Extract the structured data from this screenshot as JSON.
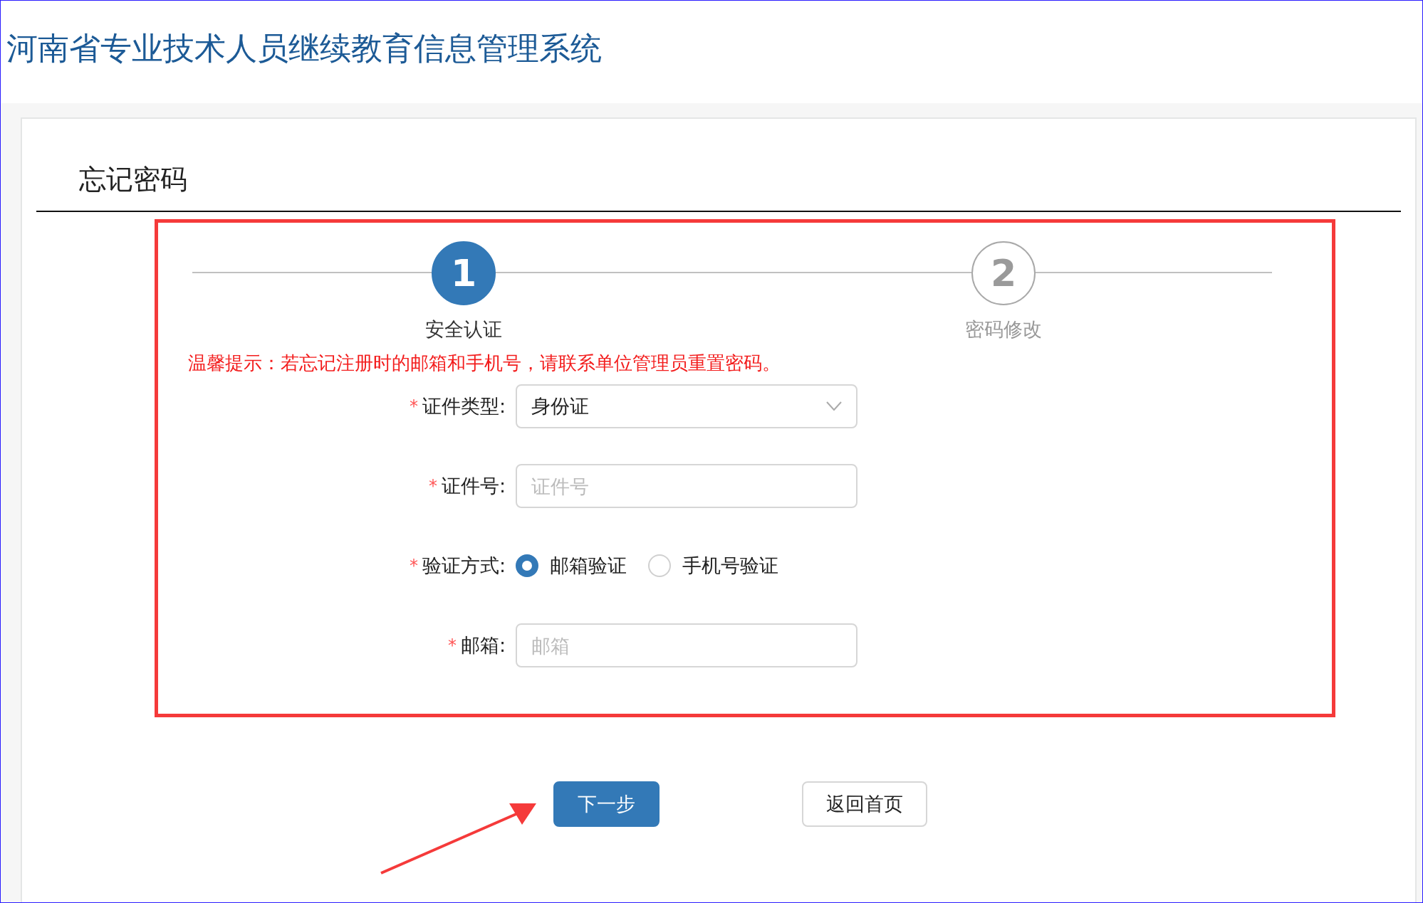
{
  "header": {
    "title": "河南省专业技术人员继续教育信息管理系统"
  },
  "page": {
    "heading": "忘记密码"
  },
  "steps": [
    {
      "number": "1",
      "label": "安全认证",
      "selected": true
    },
    {
      "number": "2",
      "label": "密码修改",
      "selected": false
    }
  ],
  "notice": "温馨提示：若忘记注册时的邮箱和手机号，请联系单位管理员重置密码。",
  "form": [
    {
      "kind": "select",
      "required_mark": "*",
      "label": "证件类型:",
      "value": "身份证"
    },
    {
      "kind": "input",
      "required_mark": "*",
      "label": "证件号:",
      "placeholder": "证件号"
    },
    {
      "kind": "radio",
      "required_mark": "*",
      "label": "验证方式:",
      "options": [
        {
          "label": "邮箱验证",
          "selected": true
        },
        {
          "label": "手机号验证",
          "selected": false
        }
      ]
    },
    {
      "kind": "input",
      "required_mark": "*",
      "label": "邮箱:",
      "placeholder": "邮箱"
    }
  ],
  "buttons": [
    {
      "kind": "primary",
      "label": "下一步"
    },
    {
      "kind": "default",
      "label": "返回首页"
    }
  ]
}
